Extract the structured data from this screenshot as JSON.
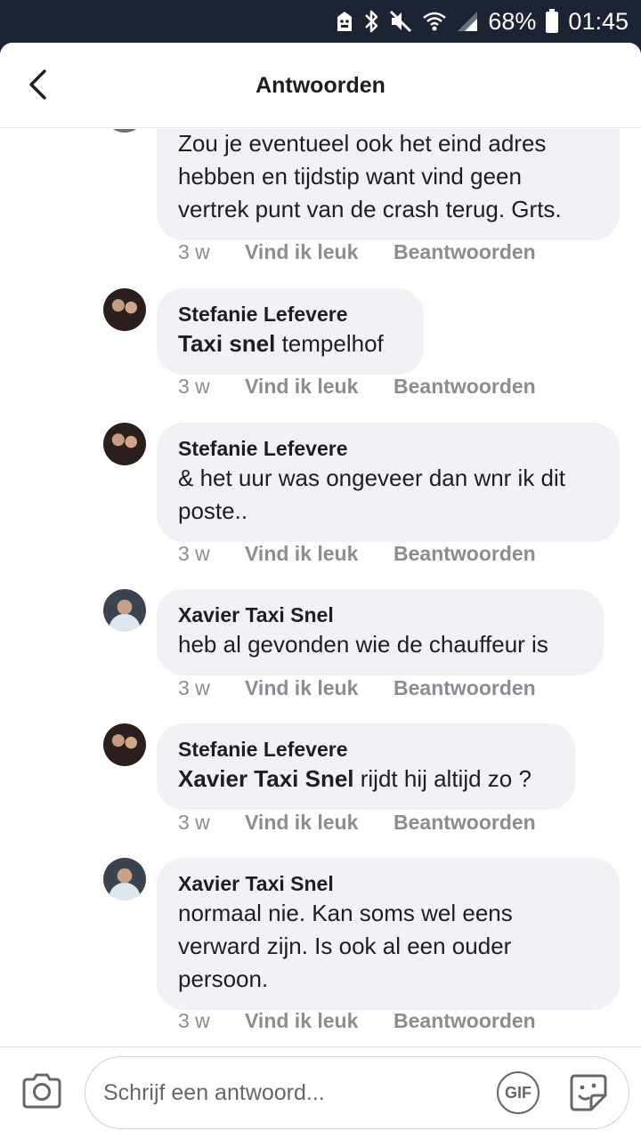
{
  "status_bar": {
    "battery": "68%",
    "time": "01:45",
    "icons": [
      "android-debug-icon",
      "bluetooth-icon",
      "mute-icon",
      "wifi-icon",
      "signal-icon",
      "battery-icon"
    ]
  },
  "header": {
    "title": "Antwoorden",
    "back_icon": "chevron-left-icon"
  },
  "comments": [
    {
      "author": "",
      "text": "Zou je eventueel ook het eind adres hebben en tijdstip want vind geen vertrek punt van de crash terug. Grts.",
      "time": "3 w",
      "like": "Vind ik leuk",
      "reply": "Beantwoorden"
    },
    {
      "author": "Stefanie Lefevere",
      "mention": "Taxi snel",
      "text": " tempelhof",
      "time": "3 w",
      "like": "Vind ik leuk",
      "reply": "Beantwoorden"
    },
    {
      "author": "Stefanie Lefevere",
      "text": "& het uur was ongeveer dan wnr ik dit poste..",
      "time": "3 w",
      "like": "Vind ik leuk",
      "reply": "Beantwoorden"
    },
    {
      "author": "Xavier Taxi Snel",
      "text": "heb al gevonden wie de chauffeur is",
      "time": "3 w",
      "like": "Vind ik leuk",
      "reply": "Beantwoorden"
    },
    {
      "author": "Stefanie Lefevere",
      "mention": "Xavier Taxi Snel",
      "text": " rijdt hij altijd zo ?",
      "time": "3 w",
      "like": "Vind ik leuk",
      "reply": "Beantwoorden"
    },
    {
      "author": "Xavier Taxi Snel",
      "text": "normaal nie. Kan soms wel eens verward zijn. Is ook al een ouder persoon.",
      "time": "3 w",
      "like": "Vind ik leuk",
      "reply": "Beantwoorden"
    }
  ],
  "composer": {
    "placeholder": "Schrijf een antwoord...",
    "gif_label": "GIF",
    "camera_icon": "camera-icon",
    "sticker_icon": "sticker-icon"
  },
  "colors": {
    "status_bar_bg": "#1c2333",
    "bubble_bg": "#f0f2f5",
    "meta_text": "#8a8d91"
  }
}
